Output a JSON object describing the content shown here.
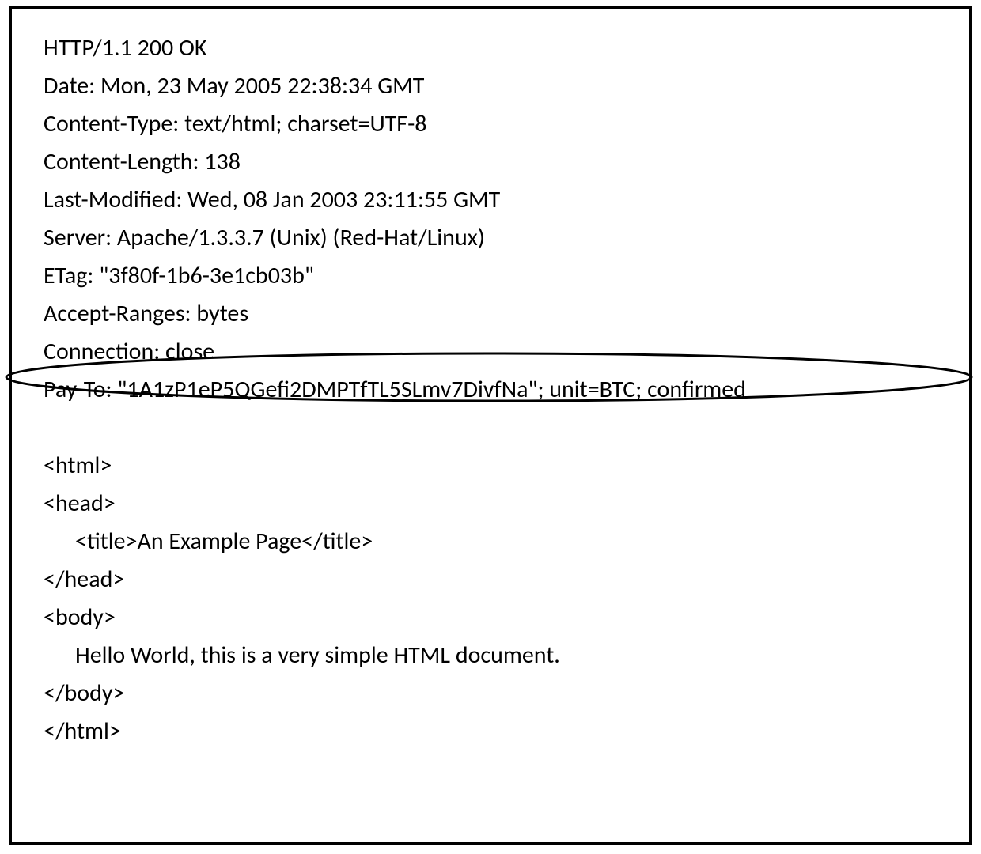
{
  "http_response": {
    "status_line": "HTTP/1.1 200 OK",
    "headers": {
      "date": "Date: Mon, 23 May 2005 22:38:34 GMT",
      "content_type": "Content-Type: text/html; charset=UTF-8",
      "content_length": "Content-Length: 138",
      "last_modified": "Last-Modified: Wed, 08 Jan 2003 23:11:55 GMT",
      "server": "Server: Apache/1.3.3.7 (Unix) (Red-Hat/Linux)",
      "etag": "ETag: \"3f80f-1b6-3e1cb03b\"",
      "accept_ranges": "Accept-Ranges: bytes",
      "connection": "Connection: close",
      "pay_to": "Pay-To: \"1A1zP1eP5QGefi2DMPTfTL5SLmv7DivfNa\"; unit=BTC; confirmed"
    },
    "body": {
      "html_open": "<html>",
      "head_open": "<head>",
      "title": "<title>An Example Page</title>",
      "head_close": "</head>",
      "body_open": "<body>",
      "content": "Hello World, this is a very simple HTML document.",
      "body_close": "</body>",
      "html_close": "</html>"
    }
  }
}
